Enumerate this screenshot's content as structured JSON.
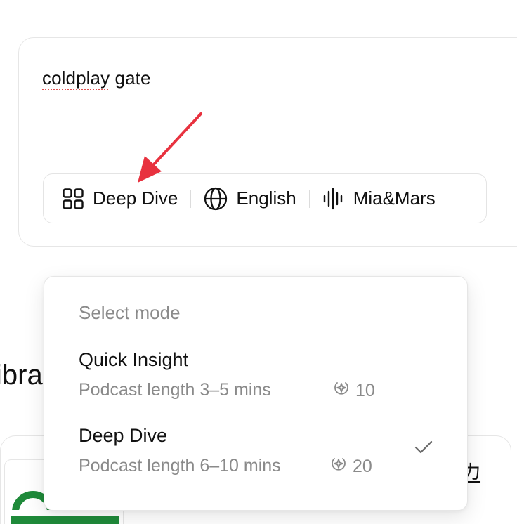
{
  "prompt": {
    "text_misspelled": "coldplay",
    "text_rest": " gate"
  },
  "options_bar": {
    "mode": {
      "label": "Deep Dive",
      "icon": "grid-icon"
    },
    "language": {
      "label": "English",
      "icon": "globe-icon"
    },
    "voice": {
      "label": "Mia&Mars",
      "icon": "waveform-icon"
    }
  },
  "background": {
    "heading_fragment": "ibra",
    "glyph_fragment": "力"
  },
  "dropdown": {
    "title": "Select mode",
    "modes": [
      {
        "name": "Quick Insight",
        "description": "Podcast length 3–5 mins",
        "credits": "10",
        "selected": false
      },
      {
        "name": "Deep Dive",
        "description": "Podcast length 6–10 mins",
        "credits": "20",
        "selected": true
      }
    ]
  },
  "colors": {
    "accent_arrow": "#e8323f",
    "muted_text": "#8a8a8a",
    "border": "#e6e6e6",
    "thumb_green": "#1f8a3a"
  }
}
